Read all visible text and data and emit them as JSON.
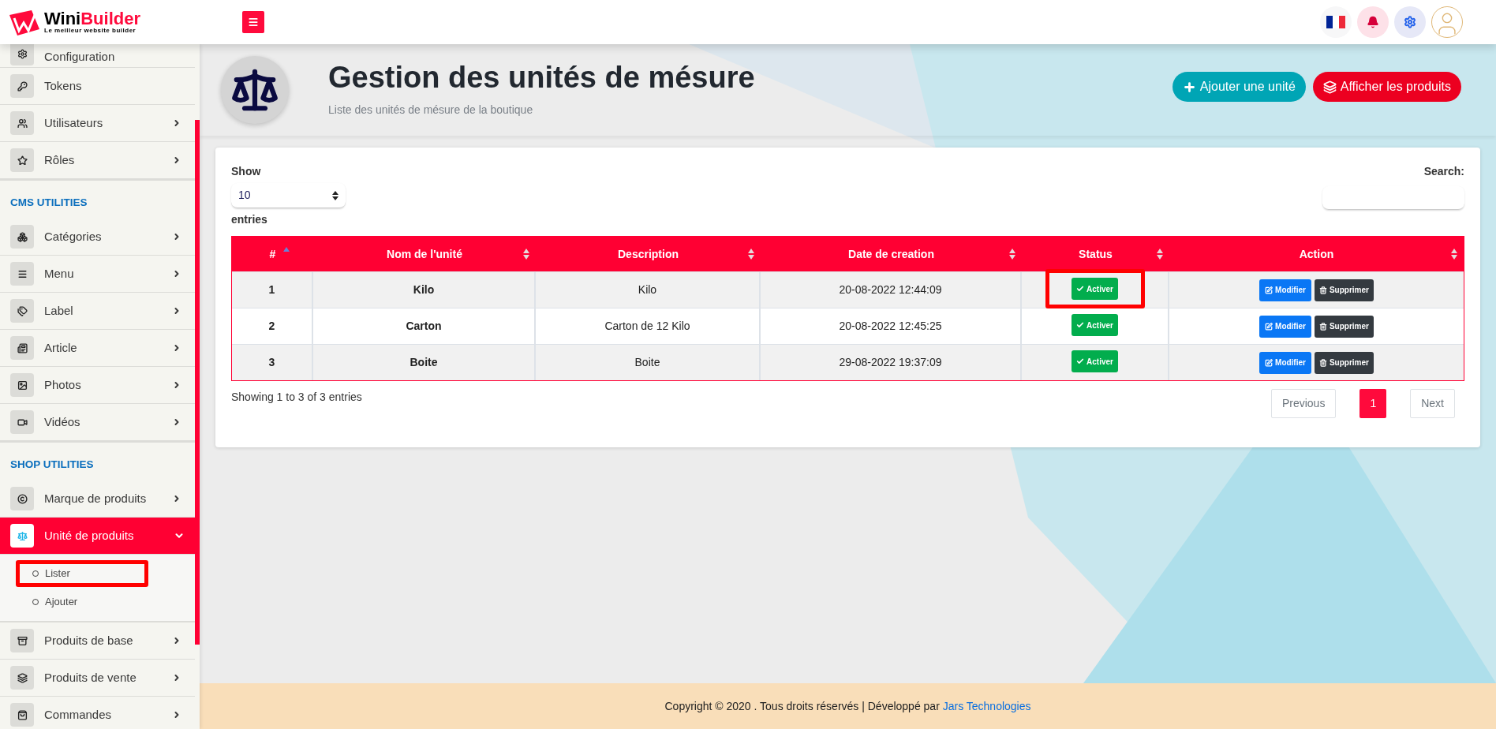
{
  "header": {
    "logo": {
      "first": "Wini",
      "second": "Builder",
      "tagline": "Le meilleur website builder"
    }
  },
  "sidebar": [
    {
      "kind": "link",
      "label": "Configuration"
    },
    {
      "kind": "link",
      "label": "Tokens"
    },
    {
      "kind": "menu",
      "label": "Utilisateurs",
      "expanded": false,
      "selected": false
    },
    {
      "kind": "menu",
      "label": "Rôles",
      "expanded": false,
      "selected": false
    },
    {
      "kind": "heading",
      "label": "CMS UTILITIES"
    },
    {
      "kind": "menu",
      "label": "Catégories",
      "expanded": false,
      "selected": false
    },
    {
      "kind": "menu",
      "label": "Menu",
      "expanded": false,
      "selected": false
    },
    {
      "kind": "menu",
      "label": "Label",
      "expanded": false,
      "selected": false
    },
    {
      "kind": "menu",
      "label": "Article",
      "expanded": false,
      "selected": false
    },
    {
      "kind": "menu",
      "label": "Photos",
      "expanded": false,
      "selected": false
    },
    {
      "kind": "menu",
      "label": "Vidéos",
      "expanded": false,
      "selected": false
    },
    {
      "kind": "heading",
      "label": "SHOP UTILITIES"
    },
    {
      "kind": "menu",
      "label": "Marque de produits",
      "expanded": false,
      "selected": false
    },
    {
      "kind": "menu",
      "label": "Unité de produits",
      "expanded": true,
      "selected": true,
      "children": [
        {
          "label": "Lister",
          "highlight": true
        },
        {
          "label": "Ajouter",
          "highlight": false
        }
      ]
    },
    {
      "kind": "menu",
      "label": "Produits de base",
      "expanded": false,
      "selected": false
    },
    {
      "kind": "menu",
      "label": "Produits de vente",
      "expanded": false,
      "selected": false
    },
    {
      "kind": "menu",
      "label": "Commandes",
      "expanded": false,
      "selected": false
    }
  ],
  "page": {
    "title": "Gestion des unités de mésure",
    "subtitle": "Liste des unités de mésure de la boutique",
    "buttons": [
      {
        "kind": "add",
        "label": "Ajouter une unité"
      },
      {
        "kind": "list",
        "label": "Afficher les produits"
      }
    ]
  },
  "table_controls": {
    "show_label": "Show",
    "page_size": "10",
    "entries_label": "entries",
    "search_label": "Search:"
  },
  "table": {
    "columns": [
      {
        "label": "#",
        "sorted": true
      },
      {
        "label": "Nom de l'unité",
        "sorted": false
      },
      {
        "label": "Description",
        "sorted": false
      },
      {
        "label": "Date de creation",
        "sorted": false
      },
      {
        "label": "Status",
        "sorted": false
      },
      {
        "label": "Action",
        "sorted": false
      }
    ],
    "rows": [
      {
        "number": "1",
        "name": "Kilo",
        "description": "Kilo",
        "date": "20-08-2022 12:44:09",
        "status": "Activer",
        "status_highlight": true,
        "edit": "Modifier",
        "delete": "Supprimer"
      },
      {
        "number": "2",
        "name": "Carton",
        "description": "Carton de 12 Kilo",
        "date": "20-08-2022 12:45:25",
        "status": "Activer",
        "status_highlight": false,
        "edit": "Modifier",
        "delete": "Supprimer"
      },
      {
        "number": "3",
        "name": "Boite",
        "description": "Boite",
        "date": "29-08-2022 19:37:09",
        "status": "Activer",
        "status_highlight": false,
        "edit": "Modifier",
        "delete": "Supprimer"
      }
    ]
  },
  "info": "Showing 1 to 3 of 3 entries",
  "pagination": [
    {
      "label": "Previous",
      "selected": false
    },
    {
      "label": "1",
      "selected": true
    },
    {
      "label": "Next",
      "selected": false
    }
  ],
  "footer": {
    "text": "Copyright © 2020 . Tous droits réservés | Développé par ",
    "link": "Jars Technologies"
  }
}
